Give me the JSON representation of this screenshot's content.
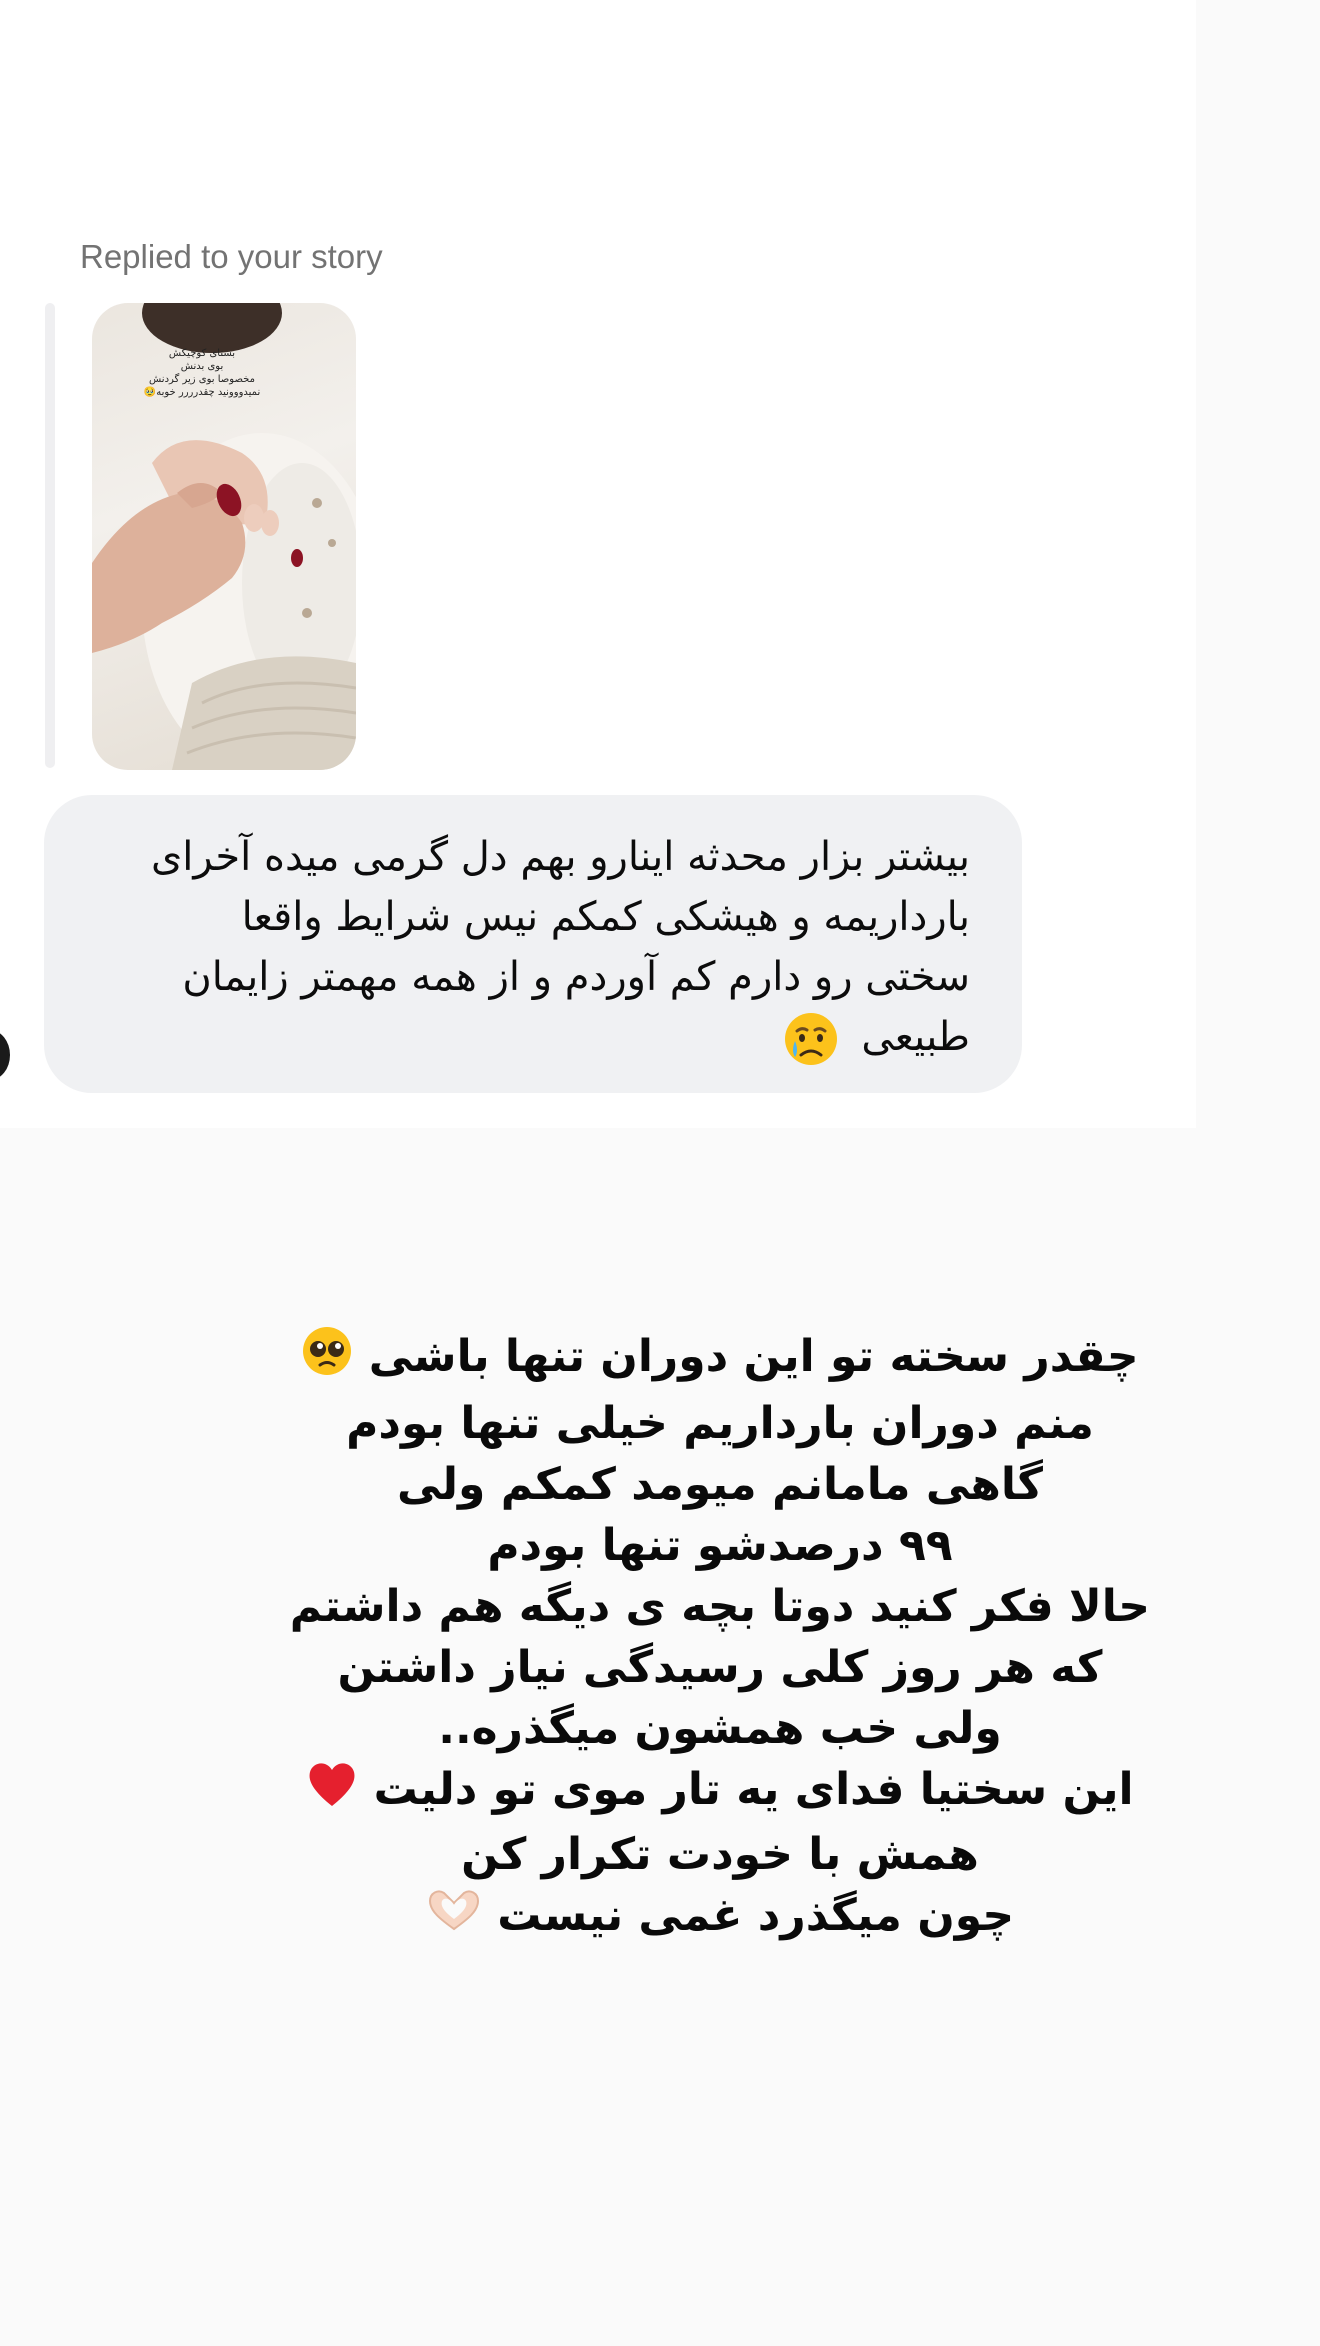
{
  "thread": {
    "reply_note": "Replied to your story",
    "story_thumbnail": {
      "overlay_lines": [
        "بستای کوچیکش",
        "بوی بدنش",
        "مخصوصا بوی زیر گردنش",
        "نمیدووونید چقدرررر خوبه🥹"
      ]
    },
    "message": {
      "lines": [
        "بیشتر بزار محدثه اینارو بهم دل گرمی میده آخرای",
        "بارداریمه و هیشکی کمکم نیس شرایط واقعا",
        "سختی رو دارم کم آوردم و از همه مهمتر زایمان",
        "طبیعی"
      ],
      "trailing_icon": "crying-face-emoji"
    }
  },
  "story": {
    "caption_lines": [
      "چقدر سخته تو این دوران تنها باشی",
      "منم دوران بارداریم خیلی تنها بودم",
      "گاهی مامانم میومد کمکم ولی",
      "۹۹ درصدشو تنها بودم",
      "حالا فکر کنید دوتا بچه ی دیگه هم داشتم",
      "که هر روز کلی رسیدگی نیاز داشتن",
      "ولی خب همشون میگذره..",
      "این سختیا فدای یه تار موی تو دلیت",
      "همش با خودت تکرار کن",
      "چون میگذرد غمی نیست"
    ],
    "line_icons": [
      "pleading-face-emoji",
      "",
      "",
      "",
      "",
      "",
      "",
      "red-heart-emoji",
      "",
      "heart-hands-emoji"
    ]
  },
  "colors": {
    "bubble": "#f0f1f3",
    "reply_bar": "#efeff1",
    "reply_note_text": "#737373",
    "page_background": "#fafafa",
    "heart": "#e5202e"
  }
}
